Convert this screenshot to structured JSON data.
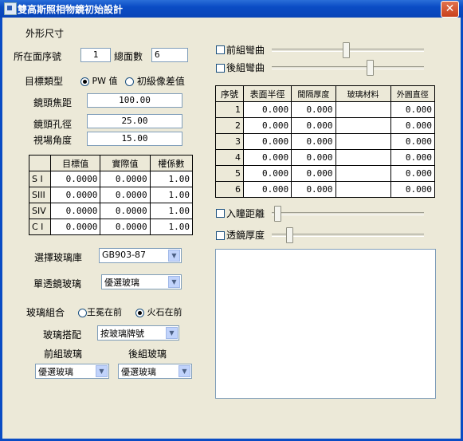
{
  "window": {
    "title": "雙高斯照相物鏡初始設計",
    "close_symbol": "✕"
  },
  "left": {
    "section_title": "外形尺寸",
    "face_no_label": "所在面序號",
    "face_no_value": "1",
    "total_faces_label": "總面數",
    "total_faces_value": "6",
    "target_type_label": "目標類型",
    "radio_pw": "PW 值",
    "radio_primary": "初級像差值",
    "focal_label": "鏡頭焦距",
    "focal_value": "100.00",
    "aperture_label": "鏡頭孔徑",
    "aperture_value": "25.00",
    "fov_label": "視場角度",
    "fov_value": "15.00",
    "aber_table": {
      "headers": [
        "目標值",
        "實際值",
        "權係數"
      ],
      "rows": [
        {
          "name": "S I",
          "target": "0.0000",
          "actual": "0.0000",
          "weight": "1.00"
        },
        {
          "name": "SIII",
          "target": "0.0000",
          "actual": "0.0000",
          "weight": "1.00"
        },
        {
          "name": "SIV",
          "target": "0.0000",
          "actual": "0.0000",
          "weight": "1.00"
        },
        {
          "name": "C I",
          "target": "0.0000",
          "actual": "0.0000",
          "weight": "1.00"
        }
      ]
    },
    "glass_lib_label": "選擇玻璃庫",
    "glass_lib_value": "GB903-87",
    "single_glass_label": "單透鏡玻璃",
    "single_glass_value": "優選玻璃",
    "combo_label": "玻璃組合",
    "radio_crown_first": "王冕在前",
    "radio_flint_first": "火石在前",
    "match_label": "玻璃搭配",
    "match_value": "按玻璃牌號",
    "front_group_label": "前組玻璃",
    "front_group_value": "優選玻璃",
    "back_group_label": "後組玻璃",
    "back_group_value": "優選玻璃"
  },
  "right": {
    "front_bend_label": "前組彎曲",
    "back_bend_label": "後組彎曲",
    "surface_table": {
      "headers": [
        "序號",
        "表面半徑",
        "間隔厚度",
        "玻璃材料",
        "外圓直徑"
      ],
      "rows": [
        {
          "no": "1",
          "radius": "0.000",
          "thickness": "0.000",
          "material": "",
          "diameter": "0.000"
        },
        {
          "no": "2",
          "radius": "0.000",
          "thickness": "0.000",
          "material": "",
          "diameter": "0.000"
        },
        {
          "no": "3",
          "radius": "0.000",
          "thickness": "0.000",
          "material": "",
          "diameter": "0.000"
        },
        {
          "no": "4",
          "radius": "0.000",
          "thickness": "0.000",
          "material": "",
          "diameter": "0.000"
        },
        {
          "no": "5",
          "radius": "0.000",
          "thickness": "0.000",
          "material": "",
          "diameter": "0.000"
        },
        {
          "no": "6",
          "radius": "0.000",
          "thickness": "0.000",
          "material": "",
          "diameter": "0.000"
        }
      ]
    },
    "pupil_label": "入瞳距離",
    "lens_thick_label": "透鏡厚度"
  },
  "colors": {
    "titlebar": "#0a4cc4",
    "face": "#ece9d8",
    "close": "#d4582e"
  }
}
